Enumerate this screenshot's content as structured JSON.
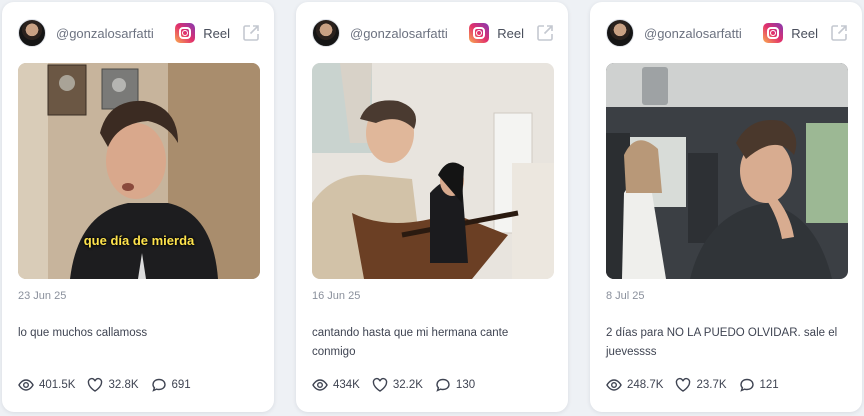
{
  "cards": [
    {
      "username": "@gonzalosarfatti",
      "type_label": "Reel",
      "thumbnail_caption": "que día de mierda",
      "date": "23 Jun 25",
      "description": "lo que muchos callamoss",
      "views": "401.5K",
      "likes": "32.8K",
      "comments": "691"
    },
    {
      "username": "@gonzalosarfatti",
      "type_label": "Reel",
      "date": "16 Jun 25",
      "description": "cantando hasta que mi hermana cante conmigo",
      "views": "434K",
      "likes": "32.2K",
      "comments": "130"
    },
    {
      "username": "@gonzalosarfatti",
      "type_label": "Reel",
      "date": "8 Jul 25",
      "description": "2 días para NO LA PUEDO OLVIDAR. sale el juevessss",
      "views": "248.7K",
      "likes": "23.7K",
      "comments": "121"
    }
  ],
  "icons": {
    "platform": "instagram-icon",
    "external": "external-link-icon",
    "views": "eye-icon",
    "likes": "heart-icon",
    "comments": "comment-icon"
  },
  "colors": {
    "background": "#eef1f5",
    "card": "#ffffff",
    "muted_text": "#8a909c",
    "text": "#3f4452"
  }
}
